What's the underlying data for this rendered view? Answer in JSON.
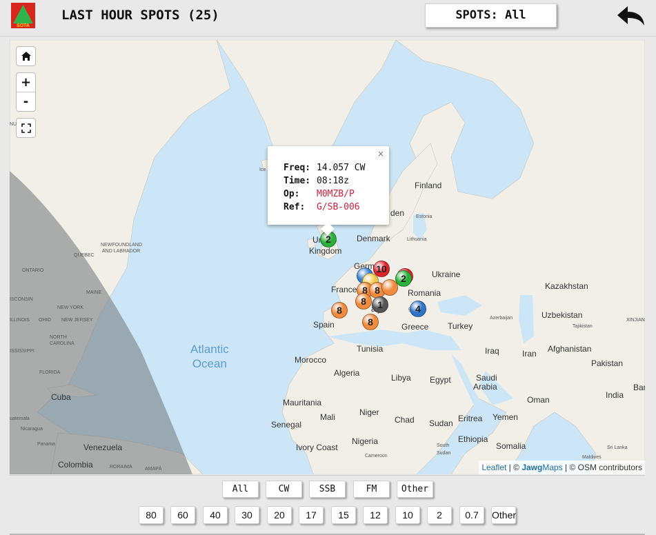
{
  "header": {
    "logo_text": "SOTA",
    "title": "LAST HOUR SPOTS (25)",
    "spots_filter_label": "SPOTS: All",
    "back_icon": "back-arrow-icon"
  },
  "map": {
    "controls": {
      "home_icon": "home-icon",
      "zoom_in": "+",
      "zoom_out": "-",
      "fullscreen_icon": "fullscreen-icon"
    },
    "popup": {
      "close": "×",
      "freq_label": "Freq:",
      "freq_value": "14.057 CW",
      "time_label": "Time:",
      "time_value": "08:18z",
      "op_label": "Op:",
      "op_value": "M0MZB/P",
      "ref_label": "Ref:",
      "ref_value": "G/SB-006"
    },
    "labels": [
      {
        "text": "Finland",
        "cls": "big"
      },
      {
        "text": "Estonia",
        "cls": "small"
      },
      {
        "text": "Lithuania",
        "cls": "small"
      },
      {
        "text": "Denmark",
        "cls": "big"
      },
      {
        "text": "Ukraine",
        "cls": "big"
      },
      {
        "text": "Romania",
        "cls": "big"
      },
      {
        "text": "Kazakhstan",
        "cls": "big"
      },
      {
        "text": "Uzbekistan",
        "cls": "big"
      },
      {
        "text": "Tajikistan",
        "cls": "small"
      },
      {
        "text": "France",
        "cls": "big"
      },
      {
        "text": "Spain",
        "cls": "big"
      },
      {
        "text": "Greece",
        "cls": "big"
      },
      {
        "text": "Turkey",
        "cls": "big"
      },
      {
        "text": "Azerbaijan",
        "cls": "small"
      },
      {
        "text": "Iraq",
        "cls": "big"
      },
      {
        "text": "Iran",
        "cls": "big"
      },
      {
        "text": "Afghanistan",
        "cls": "big"
      },
      {
        "text": "Pakistan",
        "cls": "big"
      },
      {
        "text": "Tunisia",
        "cls": "big"
      },
      {
        "text": "Morocco",
        "cls": "big"
      },
      {
        "text": "Algeria",
        "cls": "big"
      },
      {
        "text": "Libya",
        "cls": "big"
      },
      {
        "text": "Egypt",
        "cls": "big"
      },
      {
        "text": "Saudi",
        "cls": "big"
      },
      {
        "text": "Arabia",
        "cls": "big"
      },
      {
        "text": "Oman",
        "cls": "big"
      },
      {
        "text": "India",
        "cls": "big"
      },
      {
        "text": "Mauritania",
        "cls": "big"
      },
      {
        "text": "Mali",
        "cls": "big"
      },
      {
        "text": "Niger",
        "cls": "big"
      },
      {
        "text": "Chad",
        "cls": "big"
      },
      {
        "text": "Sudan",
        "cls": "big"
      },
      {
        "text": "Eritrea",
        "cls": "big"
      },
      {
        "text": "Yemen",
        "cls": "big"
      },
      {
        "text": "Senegal",
        "cls": "big"
      },
      {
        "text": "Nigeria",
        "cls": "big"
      },
      {
        "text": "Ethiopia",
        "cls": "big"
      },
      {
        "text": "Ivory Coast",
        "cls": "big"
      },
      {
        "text": "Cameroon",
        "cls": "small"
      },
      {
        "text": "South",
        "cls": "small"
      },
      {
        "text": "Sudan",
        "cls": "small"
      },
      {
        "text": "Somalia",
        "cls": "big"
      },
      {
        "text": "Sri Lanka",
        "cls": "small"
      },
      {
        "text": "Maldives",
        "cls": "small"
      },
      {
        "text": "Cuba",
        "cls": "big"
      },
      {
        "text": "Nicaragua",
        "cls": "small"
      },
      {
        "text": "Panama",
        "cls": "small"
      },
      {
        "text": "Venezuela",
        "cls": "big"
      },
      {
        "text": "Colombia",
        "cls": "big"
      },
      {
        "text": "RORAIMA",
        "cls": "small"
      },
      {
        "text": "AMAPÁ",
        "cls": "small"
      },
      {
        "text": "uatemala",
        "cls": "small"
      },
      {
        "text": "NEWFOUNDLAND",
        "cls": "small"
      },
      {
        "text": "AND LABRADOR",
        "cls": "small"
      },
      {
        "text": "QUEBEC",
        "cls": "small"
      },
      {
        "text": "ONTARIO",
        "cls": "small"
      },
      {
        "text": "MAINE",
        "cls": "small"
      },
      {
        "text": "ISCONSIN",
        "cls": "small"
      },
      {
        "text": "NEW YORK",
        "cls": "small"
      },
      {
        "text": "ILLINOIS",
        "cls": "small"
      },
      {
        "text": "OHIO",
        "cls": "small"
      },
      {
        "text": "NEW JERSEY",
        "cls": "small"
      },
      {
        "text": "NORTH",
        "cls": "small"
      },
      {
        "text": "CAROLINA",
        "cls": "small"
      },
      {
        "text": "ISSISSIPPI",
        "cls": "small"
      },
      {
        "text": "FLORIDA",
        "cls": "small"
      },
      {
        "text": "XINJIANG",
        "cls": "small"
      },
      {
        "text": "Ban",
        "cls": "big"
      },
      {
        "text": "NU",
        "cls": "small"
      },
      {
        "text": "Ice",
        "cls": "small"
      },
      {
        "text": "Un",
        "cls": "big"
      },
      {
        "text": "Kingdom",
        "cls": "big"
      },
      {
        "text": "Germ",
        "cls": "big"
      },
      {
        "text": "den",
        "cls": "big"
      },
      {
        "text": "garia",
        "cls": "small"
      },
      {
        "text": "aly",
        "cls": "big"
      }
    ],
    "ocean_label": "Atlantic\nOcean",
    "markers": [
      {
        "count": "2",
        "color": "#2bb13b"
      },
      {
        "count": "10",
        "color": "#e0242b"
      },
      {
        "count": "",
        "color": "#e0242b"
      },
      {
        "count": "",
        "color": "#3b7fd0"
      },
      {
        "count": "",
        "color": "#f2c94c"
      },
      {
        "count": "8",
        "color": "#f08a3c"
      },
      {
        "count": "8",
        "color": "#f08a3c"
      },
      {
        "count": "",
        "color": "#f08a3c"
      },
      {
        "count": "2",
        "color": "#2bb13b"
      },
      {
        "count": "8",
        "color": "#f08a3c"
      },
      {
        "count": "1",
        "color": "#555555"
      },
      {
        "count": "8",
        "color": "#f08a3c"
      },
      {
        "count": "4",
        "color": "#2f74c8"
      },
      {
        "count": "8",
        "color": "#f08a3c"
      }
    ],
    "attribution": {
      "leaflet": "Leaflet",
      "sep": " | © ",
      "jawg": "Jawg",
      "maps": "Maps",
      "osm": " | © OSM contributors"
    }
  },
  "filters": {
    "modes": [
      "All",
      "CW",
      "SSB",
      "FM",
      "Other"
    ],
    "bands": [
      "80",
      "60",
      "40",
      "30",
      "20",
      "17",
      "15",
      "12",
      "10",
      "2",
      "0.7",
      "Other"
    ]
  }
}
